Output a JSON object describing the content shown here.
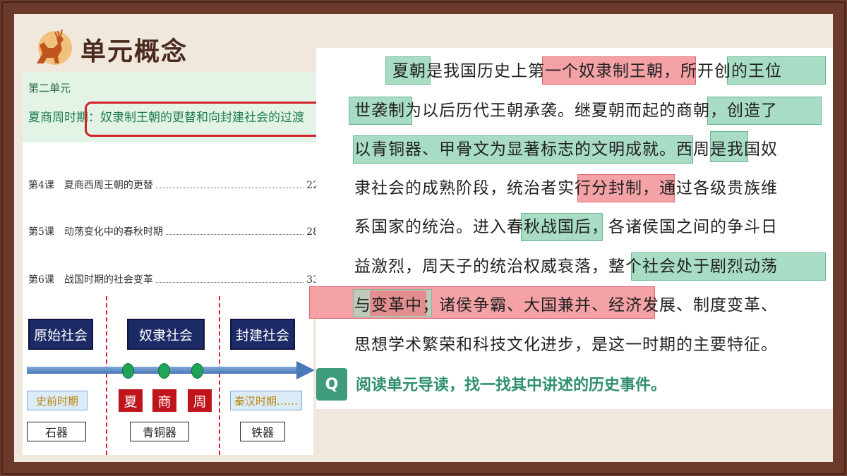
{
  "title": "单元概念",
  "toc": {
    "unit": "第二单元",
    "theme": "夏商周时期：奴隶制王朝的更替和向封建社会的过渡",
    "lessons": [
      {
        "label": "第4课　夏商西周王朝的更替",
        "page": "22"
      },
      {
        "label": "第5课　动荡变化中的春秋时期",
        "page": "28"
      },
      {
        "label": "第6课　战国时期的社会变革",
        "page": "33"
      }
    ]
  },
  "timeline": {
    "eras": [
      "原始社会",
      "奴隶社会",
      "封建社会"
    ],
    "periods": [
      "史前时期",
      "秦汉时期……"
    ],
    "dynasties": [
      "夏",
      "商",
      "周"
    ],
    "tools": [
      "石器",
      "青铜器",
      "铁器"
    ]
  },
  "paragraph": [
    "夏朝是我国历史上第一个奴隶制王朝，所开创的王位",
    "世袭制为以后历代王朝承袭。继夏朝而起的商朝，创造了",
    "以青铜器、甲骨文为显著标志的文明成就。西周是我国奴",
    "隶社会的成熟阶段，统治者实行分封制，通过各级贵族维",
    "系国家的统治。进入春秋战国后，各诸侯国之间的争斗日",
    "益激烈，周天子的统治权威衰落，整个社会处于剧烈动荡",
    "与变革中；诸侯争霸、大国兼并、经济发展、制度变革、",
    "思想学术繁荣和科技文化进步，是这一时期的主要特征。"
  ],
  "question": {
    "badge": "Q",
    "text": "阅读单元导读，找一找其中讲述的历史事件。"
  },
  "colors": {
    "frame": "#6b3a2a",
    "background": "#f1e8dd",
    "highlight_green": "#a8dcc4",
    "highlight_red": "#f4a2a6",
    "accent_green": "#3e9c7c"
  }
}
